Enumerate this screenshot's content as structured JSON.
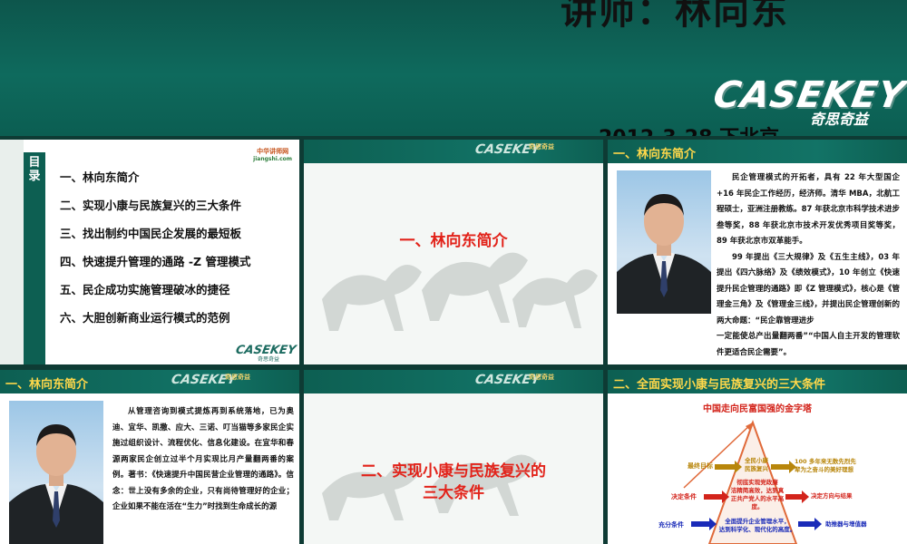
{
  "banner": {
    "lecturer": "讲师：林向东",
    "logo": "CASEKEY",
    "logo_sub": "奇思奇益",
    "date": "2012-3-28  下北京"
  },
  "header_logo": {
    "brand": "CASEKEY",
    "sub": "奇思奇益"
  },
  "slide1": {
    "toc_label": "目录",
    "badge_top": "中华讲师网",
    "badge_bottom": "jiangshi.com",
    "items": [
      "一、林向东简介",
      "二、实现小康与民族复兴的三大条件",
      "三、找出制约中国民企发展的最短板",
      "四、快速提升管理的通路 -Z 管理模式",
      "五、民企成功实施管理破冰的捷径",
      "六、大胆创新商业运行模式的范例"
    ]
  },
  "slide2": {
    "title": "一、林向东简介"
  },
  "slide3": {
    "header": "一、林向东简介",
    "paragraphs": [
      "民企管理模式的开拓者，具有 22 年大型国企 +16 年民企工作经历，经济师。清华 MBA，北航工程硕士，亚洲注册教练。87 年获北京市科学技术进步叁等奖，88 年获北京市技术开发优秀项目奖等奖，89 年获北京市双革能手。",
      "99 年提出《三大规律》及《五生主线》，03 年提出《四六脉络》及《绩效模式》，10 年创立《快速提升民企管理的通路》即《Z 管理模式》，核心是《管理金三角》及《管理金三线》，并提出民企管理创新的两大命题：“民企靠管理进步",
      "一定能使总产出量翻两番”“中国人自主开发的管理软件更适合民企需要”。"
    ]
  },
  "slide4": {
    "header": "一、林向东简介",
    "paragraph": "从管理咨询到模式提炼再到系统落地，已为奥迪、宜华、凯撒、应大、三诺、叮当猫等多家民企实施过组织设计、流程优化、信息化建设。在宜华和春源两家民企创立过半个月实现比月产量翻两番的案例。著书：《快速提升中国民营企业管理的通路》。信念：世上没有多余的企业，只有尚待管理好的企业；企业如果不能在活在“生力”时找到生命成长的源"
  },
  "slide5": {
    "title_line1": "二、实现小康与民族复兴的",
    "title_line2": "三大条件"
  },
  "slide6": {
    "header": "二、全面实现小康与民族复兴的三大条件",
    "pyramid_title": "中国走向民富国强的金字塔",
    "left_labels": [
      "最终目标",
      "决定条件",
      "充分条件"
    ],
    "center_notes": [
      "全民小康\n民族复兴",
      "彻底实现党政廉\n洁精简高效，达到真\n正共产党人的水平高\n度。",
      "全面提升企业管理水平，\n达到科学化、现代化的高度。"
    ],
    "right_notes": [
      "100 多年来无数先烈先\n辈为之奋斗的美好理想",
      "决定方向与结果",
      "助推器与增值器"
    ],
    "colors": {
      "target": "#b8860b",
      "decisive": "#d3241b",
      "sufficient": "#1a2bb8"
    }
  }
}
